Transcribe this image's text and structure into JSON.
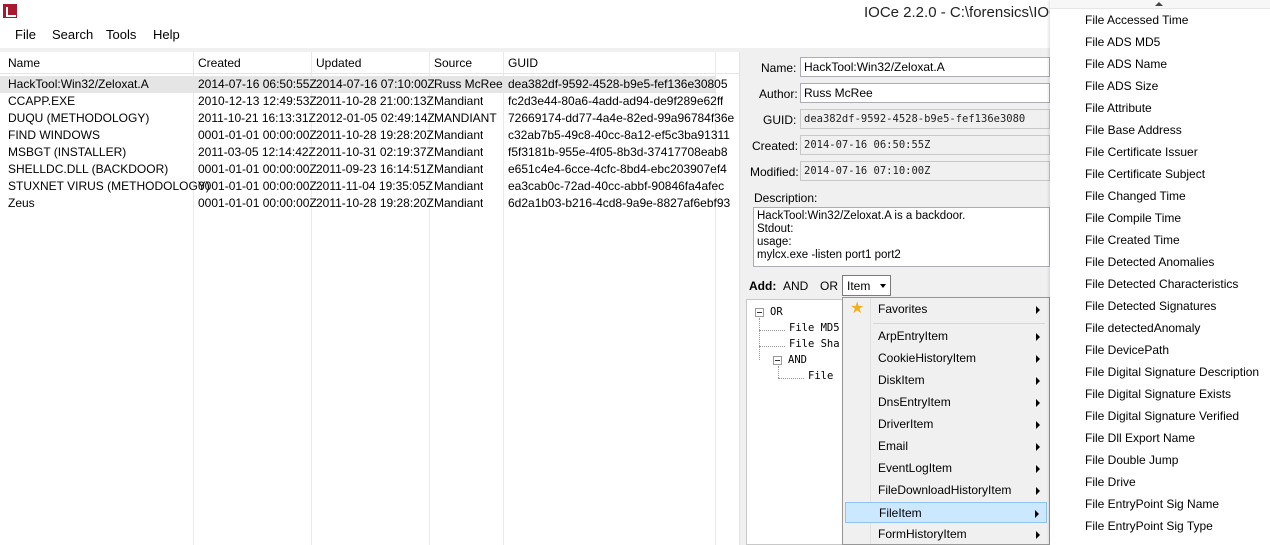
{
  "window": {
    "title": "IOCe 2.2.0 - C:\\forensics\\IOC"
  },
  "menu": [
    "File",
    "Search",
    "Tools",
    "Help"
  ],
  "ioc_list": {
    "columns": [
      "Name",
      "Created",
      "Updated",
      "Source",
      "GUID"
    ],
    "rows": [
      {
        "name": "HackTool:Win32/Zeloxat.A",
        "created": "2014-07-16 06:50:55Z",
        "updated": "2014-07-16 07:10:00Z",
        "source": "Russ McRee",
        "guid": "dea382df-9592-4528-b9e5-fef136e30805",
        "selected": true
      },
      {
        "name": "CCAPP.EXE",
        "created": "2010-12-13 12:49:53Z",
        "updated": "2011-10-28 21:00:13Z",
        "source": "Mandiant",
        "guid": "fc2d3e44-80a6-4add-ad94-de9f289e62ff"
      },
      {
        "name": "DUQU (METHODOLOGY)",
        "created": "2011-10-21 16:13:31Z",
        "updated": "2012-01-05 02:49:14Z",
        "source": "MANDIANT",
        "guid": "72669174-dd77-4a4e-82ed-99a96784f36e"
      },
      {
        "name": "FIND WINDOWS",
        "created": "0001-01-01 00:00:00Z",
        "updated": "2011-10-28 19:28:20Z",
        "source": "Mandiant",
        "guid": "c32ab7b5-49c8-40cc-8a12-ef5c3ba91311"
      },
      {
        "name": "MSBGT (INSTALLER)",
        "created": "2011-03-05 12:14:42Z",
        "updated": "2011-10-31 02:19:37Z",
        "source": "Mandiant",
        "guid": "f5f3181b-955e-4f05-8b3d-37417708eab8"
      },
      {
        "name": "SHELLDC.DLL (BACKDOOR)",
        "created": "0001-01-01 00:00:00Z",
        "updated": "2011-09-23 16:14:51Z",
        "source": "Mandiant",
        "guid": "e651c4e4-6cce-4cfc-8bd4-ebc203907ef4"
      },
      {
        "name": "STUXNET VIRUS (METHODOLOGY)",
        "created": "0001-01-01 00:00:00Z",
        "updated": "2011-11-04 19:35:05Z",
        "source": "Mandiant",
        "guid": "ea3cab0c-72ad-40cc-abbf-90846fa4afec"
      },
      {
        "name": "Zeus",
        "created": "0001-01-01 00:00:00Z",
        "updated": "2011-10-28 19:28:20Z",
        "source": "Mandiant",
        "guid": "6d2a1b03-b216-4cd8-9a9e-8827af6ebf93"
      }
    ]
  },
  "details": {
    "name_label": "Name:",
    "name": "HackTool:Win32/Zeloxat.A",
    "author_label": "Author:",
    "author": "Russ McRee",
    "guid_label": "GUID:",
    "guid": "dea382df-9592-4528-b9e5-fef136e3080",
    "created_label": "Created:",
    "created": "2014-07-16 06:50:55Z",
    "modified_label": "Modified:",
    "modified": "2014-07-16 07:10:00Z",
    "description_label": "Description:",
    "description_lines": [
      "HackTool:Win32/Zeloxat.A is a backdoor.",
      "Stdout:",
      "usage:",
      "mylcx.exe -listen port1 port2"
    ]
  },
  "add_bar": {
    "label": "Add:",
    "and": "AND",
    "or": "OR",
    "item": "Item"
  },
  "tree": {
    "root": "OR",
    "child1": "File MD5",
    "child2": "File Sha",
    "and": "AND",
    "child3": "File"
  },
  "context_menu": {
    "favorites": "Favorites",
    "items": [
      "ArpEntryItem",
      "CookieHistoryItem",
      "DiskItem",
      "DnsEntryItem",
      "DriverItem",
      "Email",
      "EventLogItem",
      "FileDownloadHistoryItem",
      "FileItem",
      "FormHistoryItem"
    ],
    "highlighted": "FileItem"
  },
  "fileitem_submenu": [
    "File Accessed Time",
    "File ADS MD5",
    "File ADS Name",
    "File ADS Size",
    "File Attribute",
    "File Base Address",
    "File Certificate Issuer",
    "File Certificate Subject",
    "File Changed Time",
    "File Compile Time",
    "File Created Time",
    "File Detected Anomalies",
    "File Detected Characteristics",
    "File Detected Signatures",
    "File detectedAnomaly",
    "File DevicePath",
    "File Digital Signature Description",
    "File Digital Signature Exists",
    "File Digital Signature Verified",
    "File Dll Export Name",
    "File Double Jump",
    "File Drive",
    "File EntryPoint Sig Name",
    "File EntryPoint Sig Type"
  ]
}
